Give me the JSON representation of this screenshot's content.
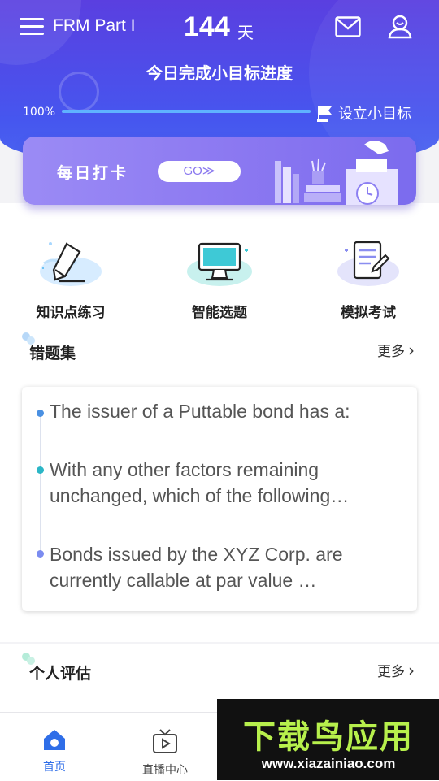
{
  "header": {
    "course": "FRM Part I",
    "days": "144",
    "days_unit": "天",
    "goal_title": "今日完成小目标进度",
    "progress_label": "100%",
    "progress_value": 1.0,
    "set_goal": "设立小目标"
  },
  "banner": {
    "text": "每日打卡",
    "go": "GO≫"
  },
  "features": [
    {
      "label": "知识点练习",
      "icon": "pencil-icon"
    },
    {
      "label": "智能选题",
      "icon": "monitor-icon"
    },
    {
      "label": "模拟考试",
      "icon": "exam-paper-icon"
    }
  ],
  "wrong_set": {
    "title": "错题集",
    "more": "更多",
    "items": [
      {
        "text": "The issuer of a Puttable bond has a:",
        "dot_color": "#4a90e2"
      },
      {
        "text": "With any other factors remaining unchanged, which of the following…",
        "dot_color": "#2bb6c6"
      },
      {
        "text": "Bonds issued by the XYZ Corp. are currently callable at par value …",
        "dot_color": "#7b8cf0"
      }
    ]
  },
  "assessment": {
    "title": "个人评估",
    "more": "更多"
  },
  "tabs": [
    {
      "label": "首页",
      "icon": "home-icon",
      "active": true
    },
    {
      "label": "直播中心",
      "icon": "tv-icon",
      "active": false
    }
  ],
  "watermark": {
    "title": "下载鸟应用",
    "url": "www.xiazainiao.com"
  },
  "colors": {
    "header_top": "#5a3fe0",
    "header_bottom": "#4a66f0",
    "accent": "#2f6ee8",
    "progress_fill": "#5fb2ff"
  }
}
